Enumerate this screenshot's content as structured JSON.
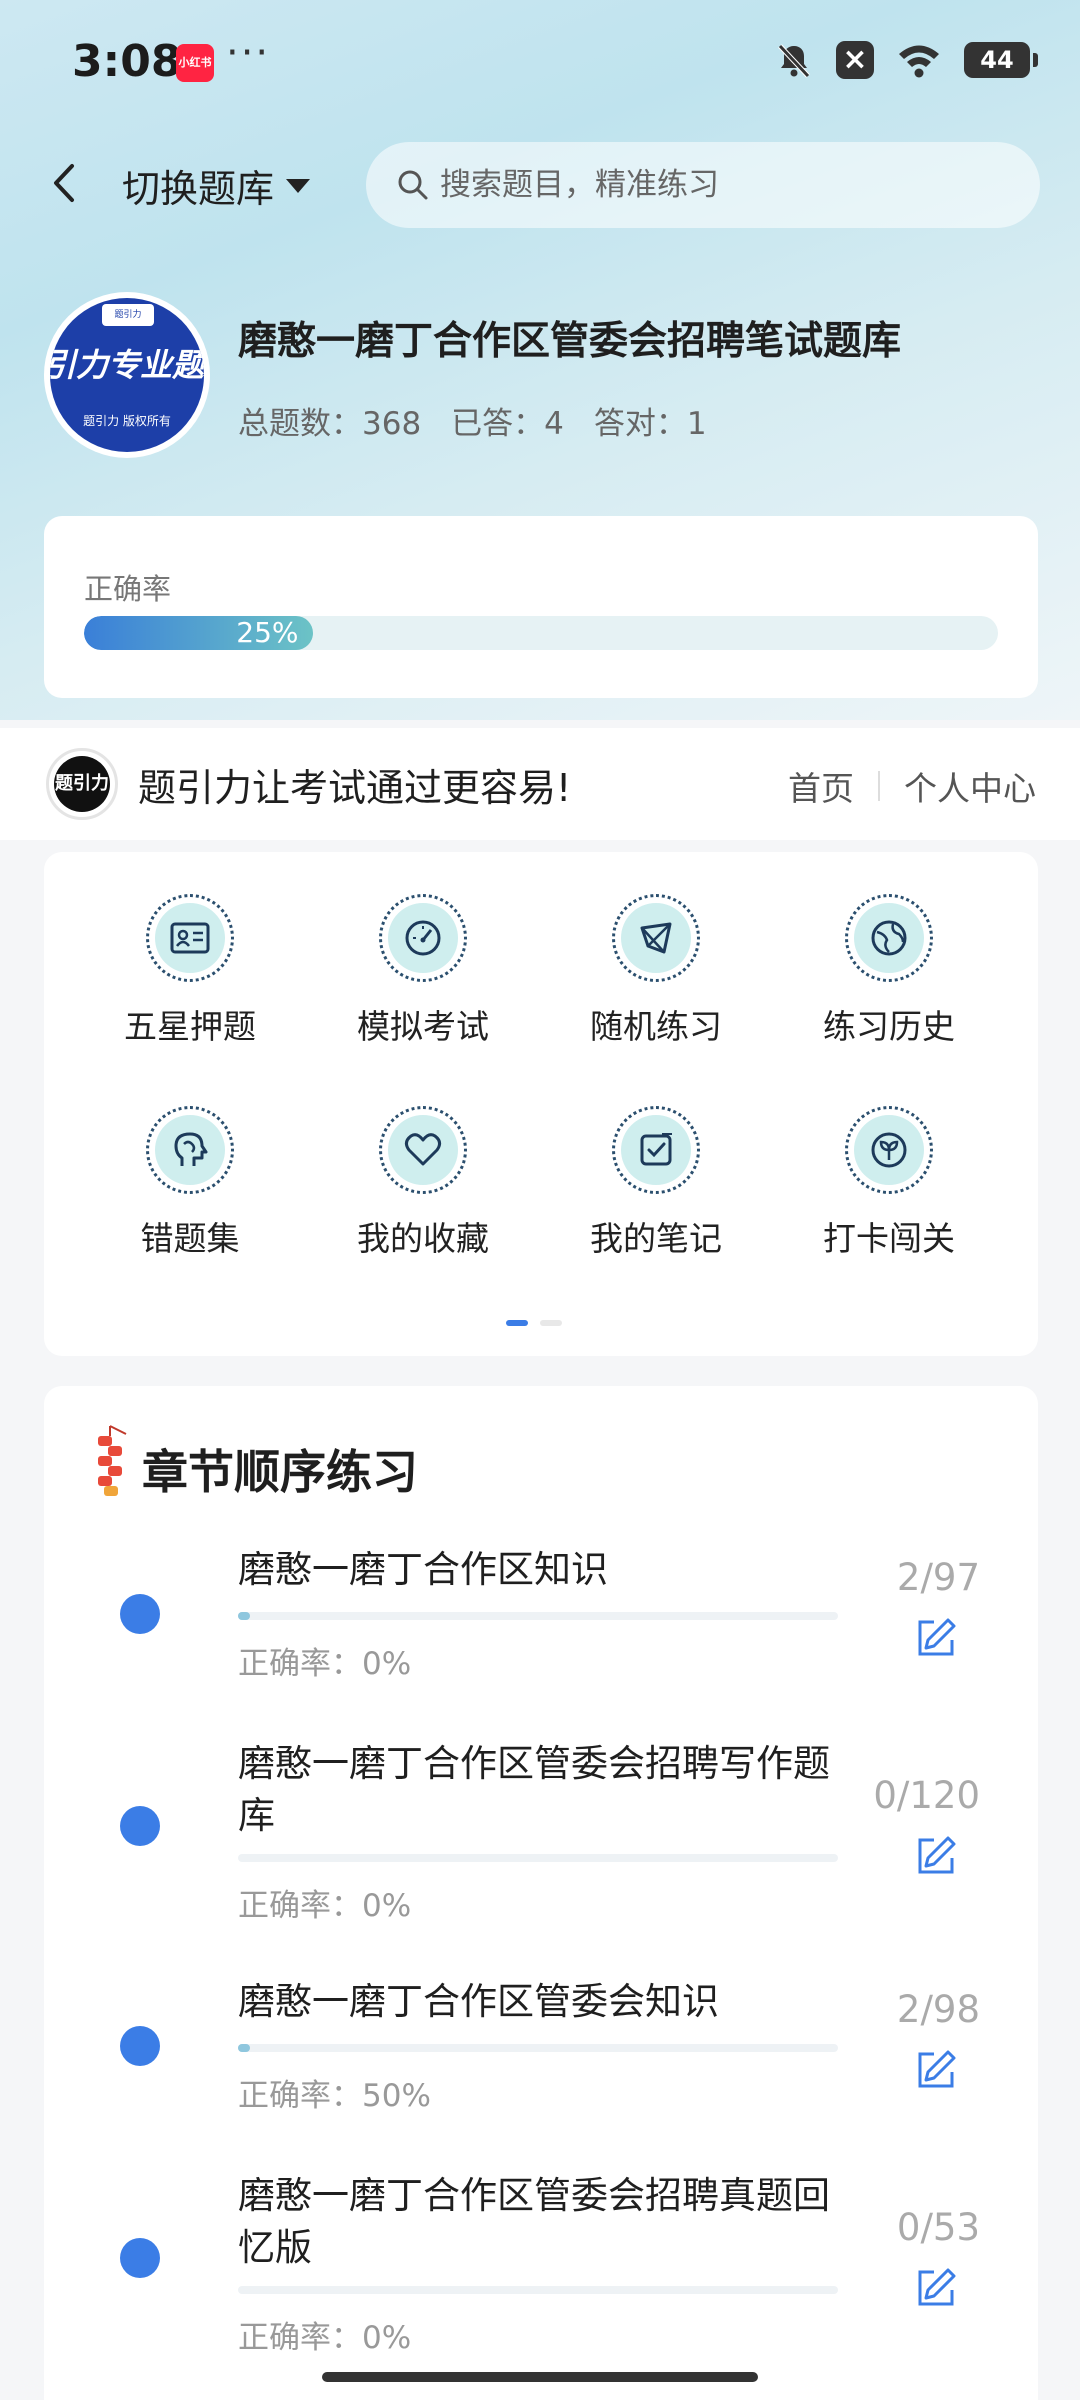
{
  "status_bar": {
    "time": "3:08",
    "app_badge": "小红书",
    "more": "···",
    "battery": "44"
  },
  "header": {
    "switch_label": "切换题库",
    "search_placeholder": "搜索题目，精准练习"
  },
  "bank": {
    "logo_text": "引力专业题",
    "logo_top": "题引力",
    "logo_sub": "题引力 版权所有",
    "title": "磨憨一磨丁合作区管委会招聘笔试题库",
    "total_label": "总题数：368",
    "answered_label": "已答：4",
    "correct_label": "答对：1"
  },
  "accuracy": {
    "label": "正确率",
    "value_text": "25%",
    "value": 25
  },
  "promo": {
    "logo_text": "题引力",
    "text": "题引力让考试通过更容易!",
    "home_link": "首页",
    "profile_link": "个人中心"
  },
  "grid": {
    "items": [
      {
        "label": "五星押题",
        "icon": "id-card-icon"
      },
      {
        "label": "模拟考试",
        "icon": "speedometer-icon"
      },
      {
        "label": "随机练习",
        "icon": "network-icon"
      },
      {
        "label": "练习历史",
        "icon": "globe-icon"
      },
      {
        "label": "错题集",
        "icon": "head-icon"
      },
      {
        "label": "我的收藏",
        "icon": "heart-icon"
      },
      {
        "label": "我的笔记",
        "icon": "checkbox-icon"
      },
      {
        "label": "打卡闯关",
        "icon": "sprout-icon"
      }
    ],
    "page_count": 2,
    "active_page": 1
  },
  "chapters": {
    "title": "章节顺序练习",
    "items": [
      {
        "name": "磨憨一磨丁合作区知识",
        "progress": "2/97",
        "progress_fraction": 0.02,
        "accuracy": "正确率：0%"
      },
      {
        "name": "磨憨一磨丁合作区管委会招聘写作题库",
        "progress": "0/120",
        "progress_fraction": 0,
        "accuracy": "正确率：0%"
      },
      {
        "name": "磨憨一磨丁合作区管委会知识",
        "progress": "2/98",
        "progress_fraction": 0.02,
        "accuracy": "正确率：50%"
      },
      {
        "name": "磨憨一磨丁合作区管委会招聘真题回忆版",
        "progress": "0/53",
        "progress_fraction": 0,
        "accuracy": "正确率：0%"
      }
    ]
  }
}
